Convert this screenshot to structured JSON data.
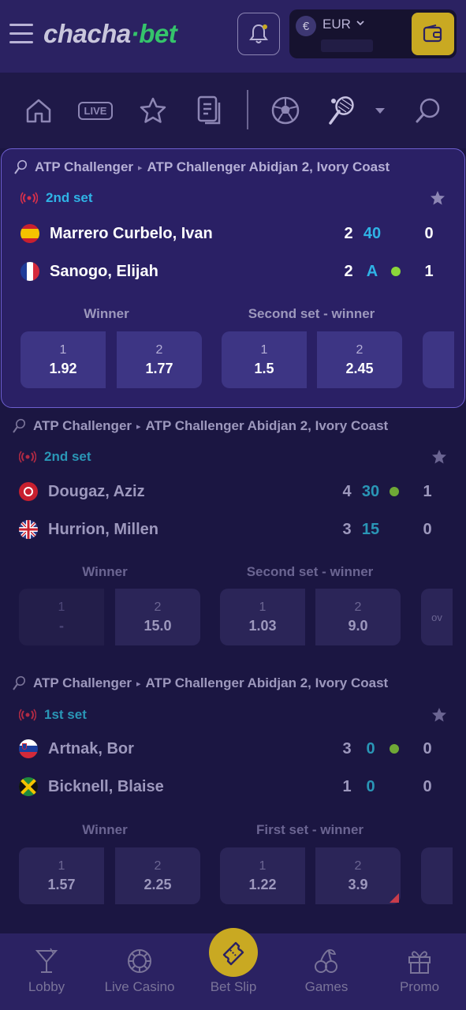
{
  "header": {
    "logo_main": "chacha",
    "logo_dot": "·",
    "logo_bet": "bet",
    "currency_symbol": "€",
    "currency": "EUR"
  },
  "nav": {
    "live_label": "LIVE"
  },
  "matches": [
    {
      "tournament_category": "ATP Challenger",
      "tournament_name": "ATP Challenger Abidjan 2, Ivory Coast",
      "status": "2nd set",
      "players": [
        {
          "name": "Marrero Curbelo, Ivan",
          "flag": "spain",
          "sets": "2",
          "game": "40",
          "total": "0",
          "serving": false
        },
        {
          "name": "Sanogo, Elijah",
          "flag": "france",
          "sets": "2",
          "game": "A",
          "total": "1",
          "serving": true
        }
      ],
      "markets": [
        {
          "label": "Winner",
          "odds": [
            {
              "label": "1",
              "value": "1.92"
            },
            {
              "label": "2",
              "value": "1.77"
            }
          ]
        },
        {
          "label": "Second set - winner",
          "odds": [
            {
              "label": "1",
              "value": "1.5"
            },
            {
              "label": "2",
              "value": "2.45"
            }
          ]
        }
      ]
    },
    {
      "tournament_category": "ATP Challenger",
      "tournament_name": "ATP Challenger Abidjan 2, Ivory Coast",
      "status": "2nd set",
      "players": [
        {
          "name": "Dougaz, Aziz",
          "flag": "tunisia",
          "sets": "4",
          "game": "30",
          "total": "1",
          "serving": true
        },
        {
          "name": "Hurrion, Millen",
          "flag": "uk",
          "sets": "3",
          "game": "15",
          "total": "0",
          "serving": false
        }
      ],
      "markets": [
        {
          "label": "Winner",
          "odds": [
            {
              "label": "1",
              "value": "-"
            },
            {
              "label": "2",
              "value": "15.0"
            }
          ]
        },
        {
          "label": "Second set - winner",
          "odds": [
            {
              "label": "1",
              "value": "1.03"
            },
            {
              "label": "2",
              "value": "9.0"
            }
          ]
        }
      ],
      "extra_odd_label": "ov"
    },
    {
      "tournament_category": "ATP Challenger",
      "tournament_name": "ATP Challenger Abidjan 2, Ivory Coast",
      "status": "1st set",
      "players": [
        {
          "name": "Artnak, Bor",
          "flag": "slovenia",
          "sets": "3",
          "game": "0",
          "total": "0",
          "serving": true
        },
        {
          "name": "Bicknell, Blaise",
          "flag": "jamaica",
          "sets": "1",
          "game": "0",
          "total": "0",
          "serving": false
        }
      ],
      "markets": [
        {
          "label": "Winner",
          "odds": [
            {
              "label": "1",
              "value": "1.57"
            },
            {
              "label": "2",
              "value": "2.25"
            }
          ]
        },
        {
          "label": "First set - winner",
          "odds": [
            {
              "label": "1",
              "value": "1.22"
            },
            {
              "label": "2",
              "value": "3.9"
            }
          ]
        }
      ]
    }
  ],
  "bottom_nav": [
    {
      "label": "Lobby",
      "icon": "cocktail-icon"
    },
    {
      "label": "Live Casino",
      "icon": "chip-icon"
    },
    {
      "label": "Bet Slip",
      "icon": "ticket-icon"
    },
    {
      "label": "Games",
      "icon": "cherries-icon"
    },
    {
      "label": "Promo",
      "icon": "gift-icon"
    }
  ],
  "colors": {
    "background": "#1b1642",
    "accent_gold": "#c9a922",
    "live_red": "#d6304b",
    "score_blue": "#2fb3e6",
    "serve_green": "#8bd63a"
  }
}
